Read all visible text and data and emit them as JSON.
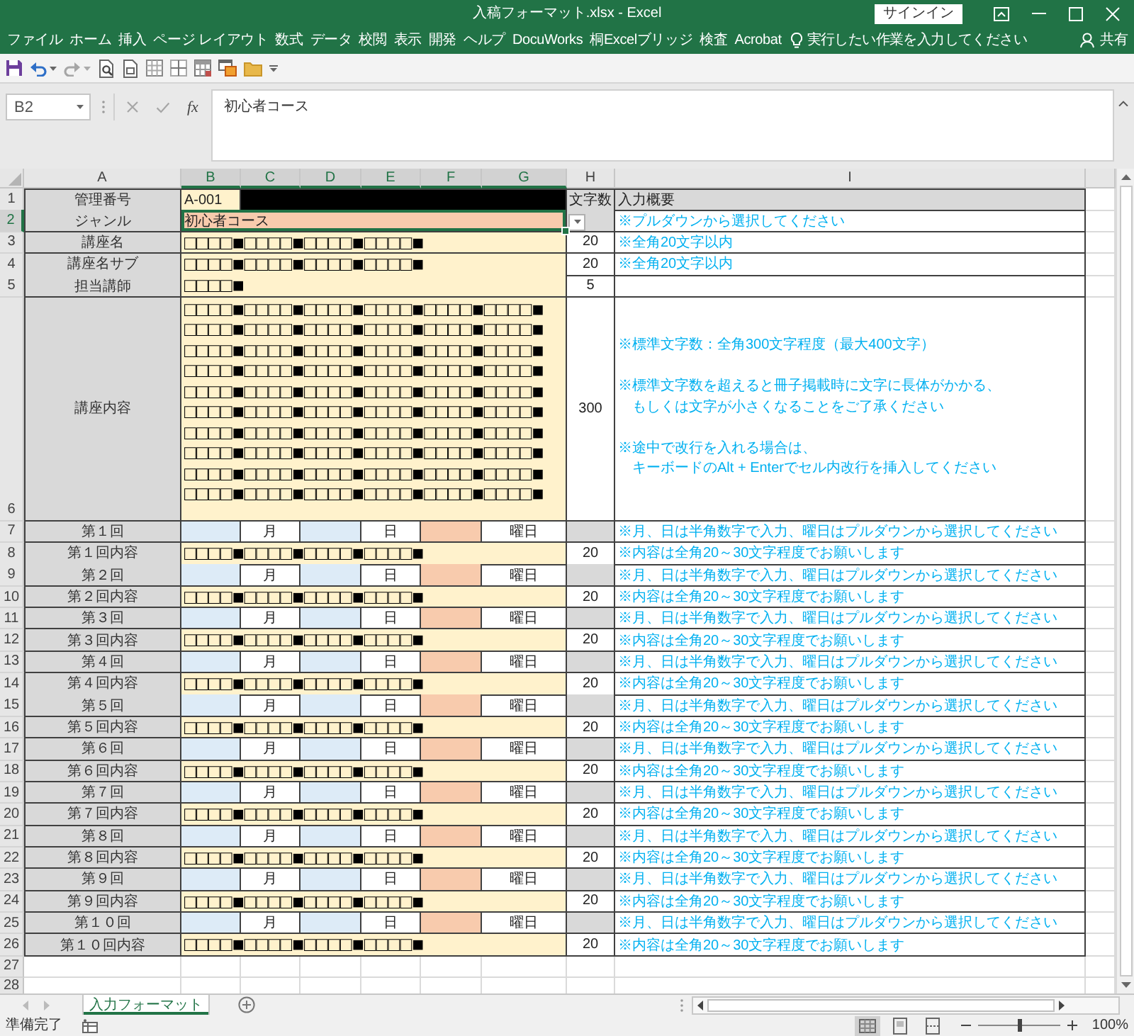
{
  "window": {
    "title": "入稿フォーマット.xlsx - Excel",
    "sign_in": "サインイン"
  },
  "ribbon": {
    "tabs": [
      {
        "label": "ファイル",
        "selected": false
      },
      {
        "label": "ホーム",
        "selected": false
      },
      {
        "label": "挿入",
        "selected": false
      },
      {
        "label": "ページ レイアウト",
        "selected": false
      },
      {
        "label": "数式",
        "selected": false
      },
      {
        "label": "データ",
        "selected": false
      },
      {
        "label": "校閲",
        "selected": false
      },
      {
        "label": "表示",
        "selected": false
      },
      {
        "label": "開発",
        "selected": false
      },
      {
        "label": "ヘルプ",
        "selected": false
      },
      {
        "label": "DocuWorks",
        "selected": false
      },
      {
        "label": "桐Excelブリッジ",
        "selected": false
      },
      {
        "label": "検査",
        "selected": false
      },
      {
        "label": "Acrobat",
        "selected": false
      }
    ],
    "tell_me": "実行したい作業を入力してください",
    "share": "共有"
  },
  "formula_bar": {
    "name_box": "B2",
    "function_button": "fx",
    "value": "初心者コース"
  },
  "sheet": {
    "columns": [
      {
        "label": "A",
        "selected": false
      },
      {
        "label": "B",
        "selected": true
      },
      {
        "label": "C",
        "selected": true
      },
      {
        "label": "D",
        "selected": true
      },
      {
        "label": "E",
        "selected": true
      },
      {
        "label": "F",
        "selected": true
      },
      {
        "label": "G",
        "selected": true
      },
      {
        "label": "H",
        "selected": false
      },
      {
        "label": "I",
        "selected": false
      }
    ],
    "rows": [
      {
        "number": "1",
        "selected": false,
        "kind": "header",
        "label": "管理番号",
        "value": "A-001",
        "count": "文字数",
        "note": "入力概要"
      },
      {
        "number": "2",
        "selected": true,
        "kind": "select",
        "label": "ジャンル",
        "value": "初心者コース",
        "note": "※プルダウンから選択してください"
      },
      {
        "number": "3",
        "selected": false,
        "kind": "field",
        "label": "講座名",
        "value": "□□□□■□□□□■□□□□■□□□□■",
        "count": "20",
        "note": "※全角20文字以内"
      },
      {
        "number": "4",
        "selected": false,
        "kind": "field",
        "label": "講座名サブ",
        "value": "□□□□■□□□□■□□□□■□□□□■",
        "count": "20",
        "note": "※全角20文字以内"
      },
      {
        "number": "5",
        "selected": false,
        "kind": "field",
        "label": "担当講師",
        "value": "□□□□■",
        "count": "5"
      },
      {
        "number": "6",
        "selected": false,
        "kind": "body",
        "label": "講座内容",
        "value": "□□□□■□□□□■□□□□■□□□□■□□□□■□□□□■\n□□□□■□□□□■□□□□■□□□□■□□□□■□□□□■\n□□□□■□□□□■□□□□■□□□□■□□□□■□□□□■\n□□□□■□□□□■□□□□■□□□□■□□□□■□□□□■\n□□□□■□□□□■□□□□■□□□□■□□□□■□□□□■\n□□□□■□□□□■□□□□■□□□□■□□□□■□□□□■\n□□□□■□□□□■□□□□■□□□□■□□□□■□□□□■\n□□□□■□□□□■□□□□■□□□□■□□□□■□□□□■\n□□□□■□□□□■□□□□■□□□□■□□□□■□□□□■\n□□□□■□□□□■□□□□■□□□□■□□□□■□□□□■",
        "count": "300",
        "note_paragraphs": [
          [
            "※標準文字数：全角300文字程度（最大400文字）"
          ],
          [
            "※標準文字数を超えると冊子掲載時に文字に長体がかかる、",
            "もしくは文字が小さくなることをご了承ください"
          ],
          [
            "※途中で改行を入れる場合は、",
            "キーボードのAlt + Enterでセル内改行を挿入してください"
          ]
        ]
      },
      {
        "number": "7",
        "selected": false,
        "kind": "date",
        "label": "第１回",
        "month": "月",
        "day": "日",
        "weekday": "曜日",
        "note": "※月、日は半角数字で入力、曜日はプルダウンから選択してください"
      },
      {
        "number": "8",
        "selected": false,
        "kind": "field",
        "label": "第１回内容",
        "value": "□□□□■□□□□■□□□□■□□□□■",
        "count": "20",
        "note": "※内容は全角20～30文字程度でお願いします"
      },
      {
        "number": "9",
        "selected": false,
        "kind": "date",
        "label": "第２回",
        "month": "月",
        "day": "日",
        "weekday": "曜日",
        "note": "※月、日は半角数字で入力、曜日はプルダウンから選択してください"
      },
      {
        "number": "10",
        "selected": false,
        "kind": "field",
        "label": "第２回内容",
        "value": "□□□□■□□□□■□□□□■□□□□■",
        "count": "20",
        "note": "※内容は全角20～30文字程度でお願いします"
      },
      {
        "number": "11",
        "selected": false,
        "kind": "date",
        "label": "第３回",
        "month": "月",
        "day": "日",
        "weekday": "曜日",
        "note": "※月、日は半角数字で入力、曜日はプルダウンから選択してください"
      },
      {
        "number": "12",
        "selected": false,
        "kind": "field",
        "label": "第３回内容",
        "value": "□□□□■□□□□■□□□□■□□□□■",
        "count": "20",
        "note": "※内容は全角20～30文字程度でお願いします"
      },
      {
        "number": "13",
        "selected": false,
        "kind": "date",
        "label": "第４回",
        "month": "月",
        "day": "日",
        "weekday": "曜日",
        "note": "※月、日は半角数字で入力、曜日はプルダウンから選択してください"
      },
      {
        "number": "14",
        "selected": false,
        "kind": "field",
        "label": "第４回内容",
        "value": "□□□□■□□□□■□□□□■□□□□■",
        "count": "20",
        "note": "※内容は全角20～30文字程度でお願いします"
      },
      {
        "number": "15",
        "selected": false,
        "kind": "date",
        "label": "第５回",
        "month": "月",
        "day": "日",
        "weekday": "曜日",
        "note": "※月、日は半角数字で入力、曜日はプルダウンから選択してください"
      },
      {
        "number": "16",
        "selected": false,
        "kind": "field",
        "label": "第５回内容",
        "value": "□□□□■□□□□■□□□□■□□□□■",
        "count": "20",
        "note": "※内容は全角20～30文字程度でお願いします"
      },
      {
        "number": "17",
        "selected": false,
        "kind": "date",
        "label": "第６回",
        "month": "月",
        "day": "日",
        "weekday": "曜日",
        "note": "※月、日は半角数字で入力、曜日はプルダウンから選択してください"
      },
      {
        "number": "18",
        "selected": false,
        "kind": "field",
        "label": "第６回内容",
        "value": "□□□□■□□□□■□□□□■□□□□■",
        "count": "20",
        "note": "※内容は全角20～30文字程度でお願いします"
      },
      {
        "number": "19",
        "selected": false,
        "kind": "date",
        "label": "第７回",
        "month": "月",
        "day": "日",
        "weekday": "曜日",
        "note": "※月、日は半角数字で入力、曜日はプルダウンから選択してください"
      },
      {
        "number": "20",
        "selected": false,
        "kind": "field",
        "label": "第７回内容",
        "value": "□□□□■□□□□■□□□□■□□□□■",
        "count": "20",
        "note": "※内容は全角20～30文字程度でお願いします"
      },
      {
        "number": "21",
        "selected": false,
        "kind": "date",
        "label": "第８回",
        "month": "月",
        "day": "日",
        "weekday": "曜日",
        "note": "※月、日は半角数字で入力、曜日はプルダウンから選択してください"
      },
      {
        "number": "22",
        "selected": false,
        "kind": "field",
        "label": "第８回内容",
        "value": "□□□□■□□□□■□□□□■□□□□■",
        "count": "20",
        "note": "※内容は全角20～30文字程度でお願いします"
      },
      {
        "number": "23",
        "selected": false,
        "kind": "date",
        "label": "第９回",
        "month": "月",
        "day": "日",
        "weekday": "曜日",
        "note": "※月、日は半角数字で入力、曜日はプルダウンから選択してください"
      },
      {
        "number": "24",
        "selected": false,
        "kind": "field",
        "label": "第９回内容",
        "value": "□□□□■□□□□■□□□□■□□□□■",
        "count": "20",
        "note": "※内容は全角20～30文字程度でお願いします"
      },
      {
        "number": "25",
        "selected": false,
        "kind": "date",
        "label": "第１０回",
        "month": "月",
        "day": "日",
        "weekday": "曜日",
        "note": "※月、日は半角数字で入力、曜日はプルダウンから選択してください"
      },
      {
        "number": "26",
        "selected": false,
        "kind": "field",
        "label": "第１０回内容",
        "value": "□□□□■□□□□■□□□□■□□□□■",
        "count": "20",
        "note": "※内容は全角20～30文字程度でお願いします"
      },
      {
        "number": "27",
        "selected": false,
        "kind": "empty"
      },
      {
        "number": "28",
        "selected": false,
        "kind": "empty"
      }
    ]
  },
  "sheet_tabs": [
    {
      "label": "入力フォーマット",
      "selected": true
    }
  ],
  "status_bar": {
    "status": "準備完了",
    "views": [
      {
        "kind": "normal",
        "selected": true
      },
      {
        "kind": "page_layout",
        "selected": false
      },
      {
        "kind": "page_break",
        "selected": false
      }
    ],
    "zoom": {
      "level": 0.5,
      "reading": "100%"
    }
  }
}
